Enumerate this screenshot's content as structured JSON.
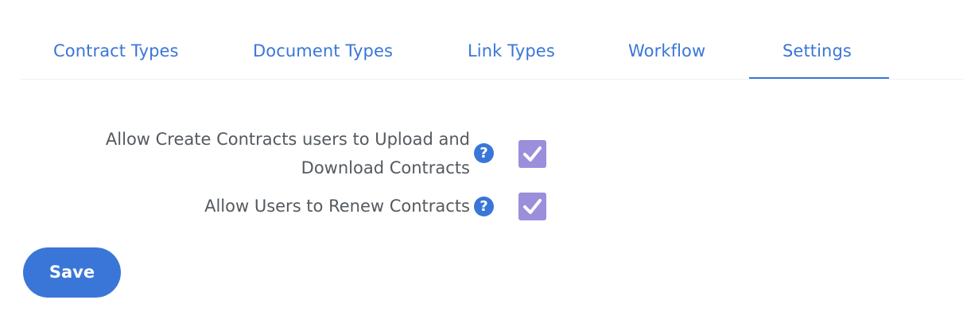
{
  "tabs": [
    {
      "label": "Contract Types",
      "active": false
    },
    {
      "label": "Document Types",
      "active": false
    },
    {
      "label": "Link Types",
      "active": false
    },
    {
      "label": "Workflow",
      "active": false
    },
    {
      "label": "Settings",
      "active": true
    }
  ],
  "settings": [
    {
      "label_line1": "Allow Create Contracts users to Upload and",
      "label_line2": "Download Contracts",
      "help_icon": "question-circle-icon",
      "checked": true
    },
    {
      "label_line1": "Allow Users to Renew Contracts",
      "help_icon": "question-circle-icon",
      "checked": true
    }
  ],
  "actions": {
    "save_label": "Save"
  },
  "colors": {
    "accent": "#3a76d8",
    "checkbox": "#9b8fdb",
    "label_text": "#555a5f"
  }
}
